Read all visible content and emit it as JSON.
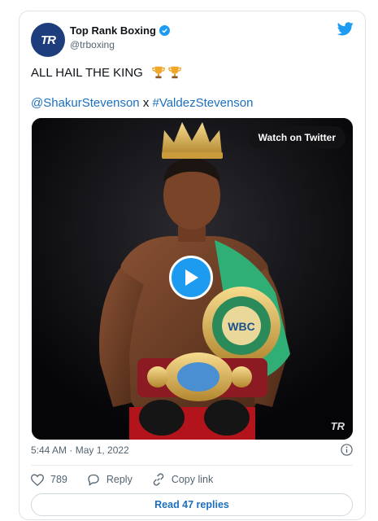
{
  "tweet": {
    "author_name": "Top Rank Boxing",
    "author_handle": "@trboxing",
    "avatar_text": "TR",
    "text": "ALL HAIL THE KING",
    "hashtag_1": "@ShakurStevenson",
    "connector": "x",
    "hashtag_2": "#ValdezStevenson",
    "media": {
      "watch_label": "Watch on Twitter",
      "watermark": "TR",
      "belt_wbc_text": "WBC"
    },
    "timestamp": "5:44 AM · May 1, 2022",
    "likes": "789",
    "reply_label": "Reply",
    "copy_link_label": "Copy link",
    "read_replies_label": "Read 47 replies"
  },
  "colors": {
    "twitter_blue": "#1d9bf0",
    "link_blue": "#1b6fbe",
    "avatar_bg": "#1d3d7c",
    "muted": "#536471"
  },
  "icons": [
    "verified-badge-icon",
    "twitter-bird-icon",
    "trophy-icon",
    "play-icon",
    "info-icon",
    "heart-icon",
    "reply-icon",
    "link-icon"
  ]
}
